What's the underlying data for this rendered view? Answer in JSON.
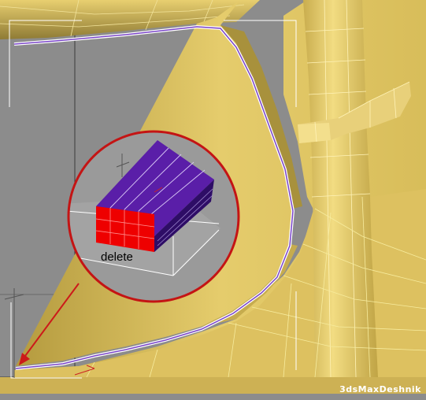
{
  "viewport": {
    "background": "#8c8c8c",
    "mesh_color": "#e2c766",
    "mesh_shadow": "#9c8a40",
    "wire_color": "#f7ec9e",
    "selection_color": "#7a45c9",
    "accent": "#cc1a1a"
  },
  "callout": {
    "label": "delete",
    "highlight_color": "#ff0000",
    "poly_color": "#5a1ea8"
  },
  "watermark": {
    "text": "3dsMaxDeshnik"
  }
}
